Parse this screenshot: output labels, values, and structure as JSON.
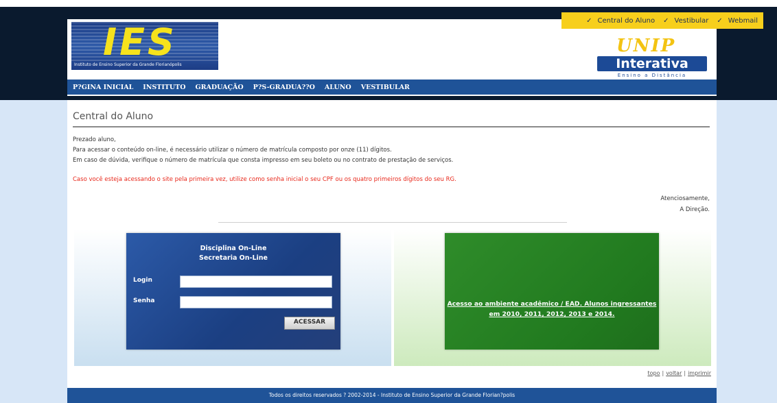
{
  "top_links": {
    "check": "✓",
    "items": [
      "Central do Aluno",
      "Vestibular",
      "Webmail"
    ]
  },
  "logo_ies": {
    "letters": "IES",
    "tagline": "Instituto de Ensino Superior da Grande Florianópolis"
  },
  "logo_unip": {
    "unip": "UNIP",
    "interativa": "Interativa",
    "ead": "Ensino a Distância"
  },
  "nav": {
    "items": [
      "P?GINA INICIAL",
      "INSTITUTO",
      "GRADUAÇÃO",
      "P?S-GRADUA??O",
      "ALUNO",
      "VESTIBULAR"
    ]
  },
  "main": {
    "title": "Central do Aluno",
    "lines": [
      "Prezado aluno,",
      "Para acessar o conteúdo on-line, é necessário utilizar o número de matrícula composto por onze (11) dígitos.",
      "Em caso de dúvida, verifique o número de matrícula que consta impresso em seu boleto ou no contrato de prestação de serviços."
    ],
    "warning": "Caso você esteja acessando o site pela primeira vez, utilize como senha inicial o seu CPF ou os quatro primeiros dígitos do seu RG.",
    "signoff": [
      "Atenciosamente,",
      "A Direção."
    ]
  },
  "login": {
    "title_line1": "Disciplina On-Line",
    "title_line2": "Secretaria On-Line",
    "login_label": "Login",
    "login_value": "",
    "password_label": "Senha",
    "password_value": "",
    "submit_label": "ACESSAR"
  },
  "ead": {
    "link_text": "Acesso ao ambiente acadêmico / EAD. Alunos ingressantes em 2010, 2011, 2012, 2013 e 2014."
  },
  "utils": {
    "top": "topo",
    "back": "voltar",
    "print": "imprimir",
    "separator": "|"
  },
  "footer": {
    "text": "Todos os direitos reservados ? 2002-2014 - Instituto de Ensino Superior da Grande Florian?polis"
  },
  "colors": {
    "nav_blue": "#1f5398",
    "accent_yellow": "#f7cf1c",
    "warning_red": "#e8281b",
    "ead_green": "#2f8c2a"
  }
}
